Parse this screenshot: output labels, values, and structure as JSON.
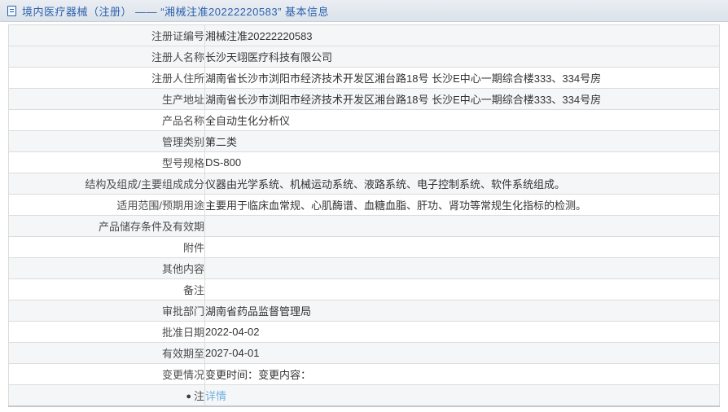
{
  "header": {
    "icon": "document-icon",
    "title": "境内医疗器械（注册） —— “湘械注准20222220583” 基本信息"
  },
  "colors": {
    "title_blue": "#2b61ad",
    "link_blue": "#6fb3e0",
    "stripe_gray": "#f5f6f8",
    "border_gray": "#dcdcdc"
  },
  "table": {
    "rows": [
      {
        "label": "注册证编号",
        "value": "湘械注准20222220583"
      },
      {
        "label": "注册人名称",
        "value": "长沙天翊医疗科技有限公司"
      },
      {
        "label": "注册人住所",
        "value": "湖南省长沙市浏阳市经济技术开发区湘台路18号 长沙E中心一期综合楼333、334号房"
      },
      {
        "label": "生产地址",
        "value": "湖南省长沙市浏阳市经济技术开发区湘台路18号 长沙E中心一期综合楼333、334号房"
      },
      {
        "label": "产品名称",
        "value": "全自动生化分析仪"
      },
      {
        "label": "管理类别",
        "value": "第二类"
      },
      {
        "label": "型号规格",
        "value": "DS-800"
      },
      {
        "label": "结构及组成/主要组成成分",
        "value": "仪器由光学系统、机械运动系统、液路系统、电子控制系统、软件系统组成。"
      },
      {
        "label": "适用范围/预期用途",
        "value": "主要用于临床血常规、心肌酶谱、血糖血脂、肝功、肾功等常规生化指标的检测。"
      },
      {
        "label": "产品储存条件及有效期",
        "value": ""
      },
      {
        "label": "附件",
        "value": ""
      },
      {
        "label": "其他内容",
        "value": ""
      },
      {
        "label": "备注",
        "value": ""
      },
      {
        "label": "审批部门",
        "value": "湖南省药品监督管理局"
      },
      {
        "label": "批准日期",
        "value": "2022-04-02"
      },
      {
        "label": "有效期至",
        "value": "2027-04-01"
      },
      {
        "label": "变更情况",
        "value": "变更时间：变更内容："
      },
      {
        "label": "注",
        "icon": "●",
        "value": "详情",
        "link": true
      }
    ]
  }
}
